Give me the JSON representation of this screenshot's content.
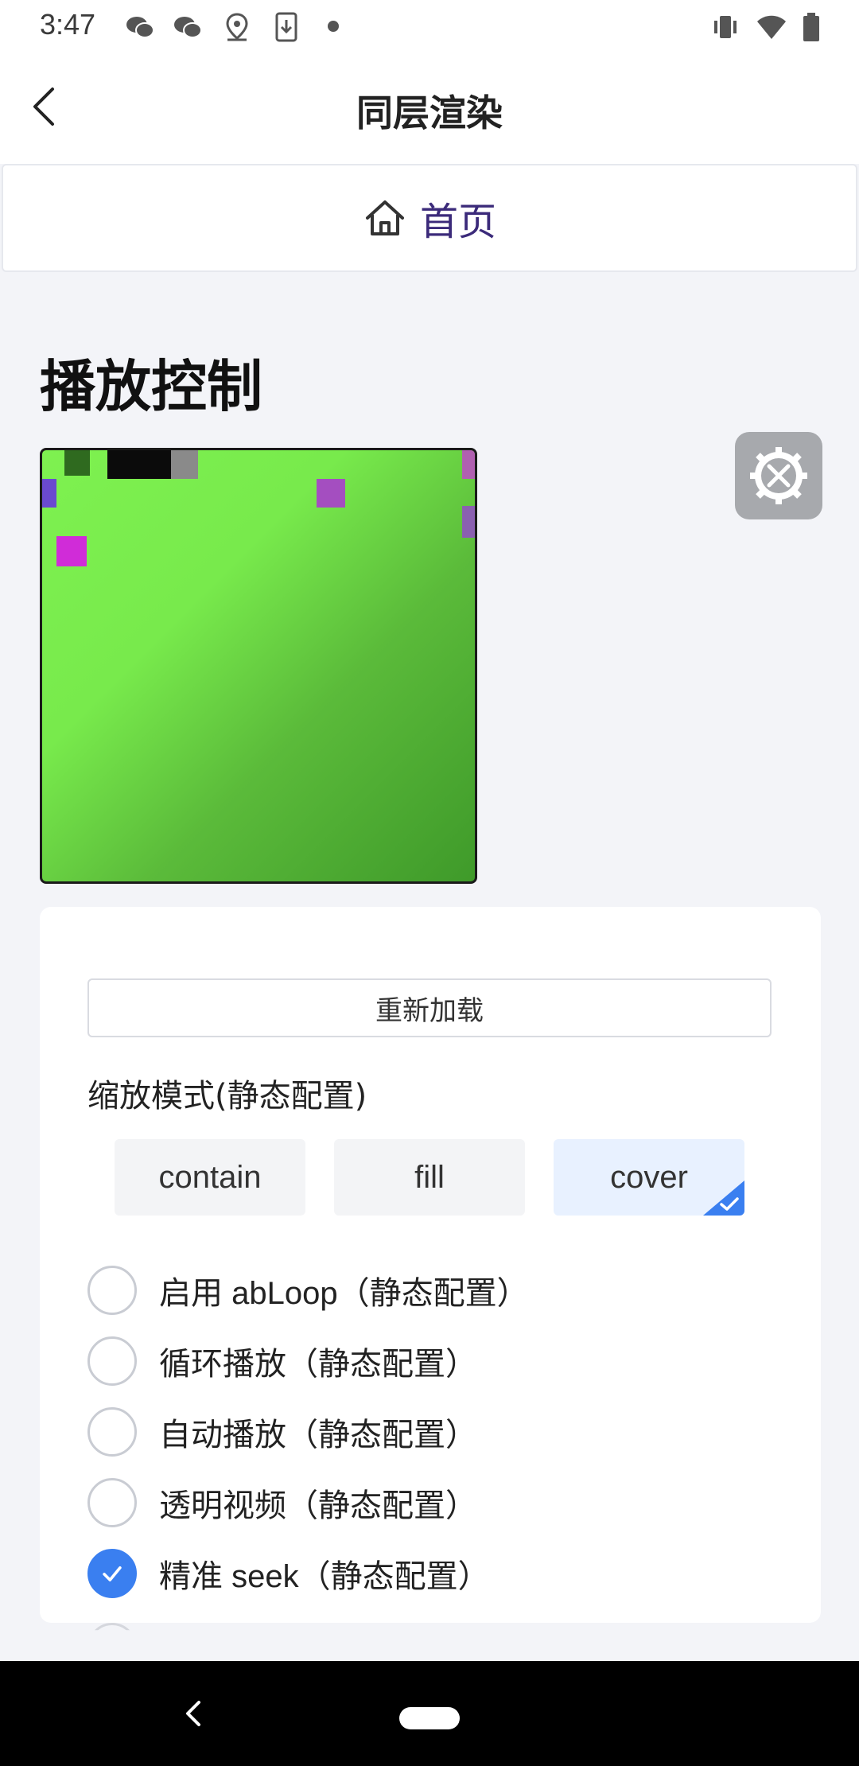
{
  "status_bar": {
    "time": "3:47",
    "left_icons": [
      "wechat-icon",
      "wechat-icon",
      "location-icon",
      "download-icon",
      "dot-icon"
    ],
    "right_icons": [
      "vibrate-icon",
      "wifi-icon",
      "battery-icon"
    ]
  },
  "header": {
    "title": "同层渲染",
    "back_icon": "chevron-left-icon"
  },
  "home_link": {
    "label": "首页",
    "icon": "home-icon"
  },
  "section": {
    "title": "播放控制"
  },
  "settings_icon": "wrench-screwdriver-gear-icon",
  "controls": {
    "reload_label": "重新加载",
    "mode_label": "缩放模式(静态配置)",
    "modes": [
      {
        "label": "contain",
        "selected": false
      },
      {
        "label": "fill",
        "selected": false
      },
      {
        "label": "cover",
        "selected": true
      }
    ],
    "options": [
      {
        "label": "启用 abLoop（静态配置）",
        "checked": false
      },
      {
        "label": "循环播放（静态配置）",
        "checked": false
      },
      {
        "label": "自动播放（静态配置）",
        "checked": false
      },
      {
        "label": "透明视频（静态配置）",
        "checked": false
      },
      {
        "label": "精准 seek（静态配置）",
        "checked": true
      }
    ]
  },
  "colors": {
    "accent": "#3a7ff0",
    "home_text": "#3b2a7a",
    "video_green": "#7ef150"
  },
  "system_nav": {
    "back_icon": "back-triangle-icon",
    "home_icon": "home-pill-icon"
  }
}
